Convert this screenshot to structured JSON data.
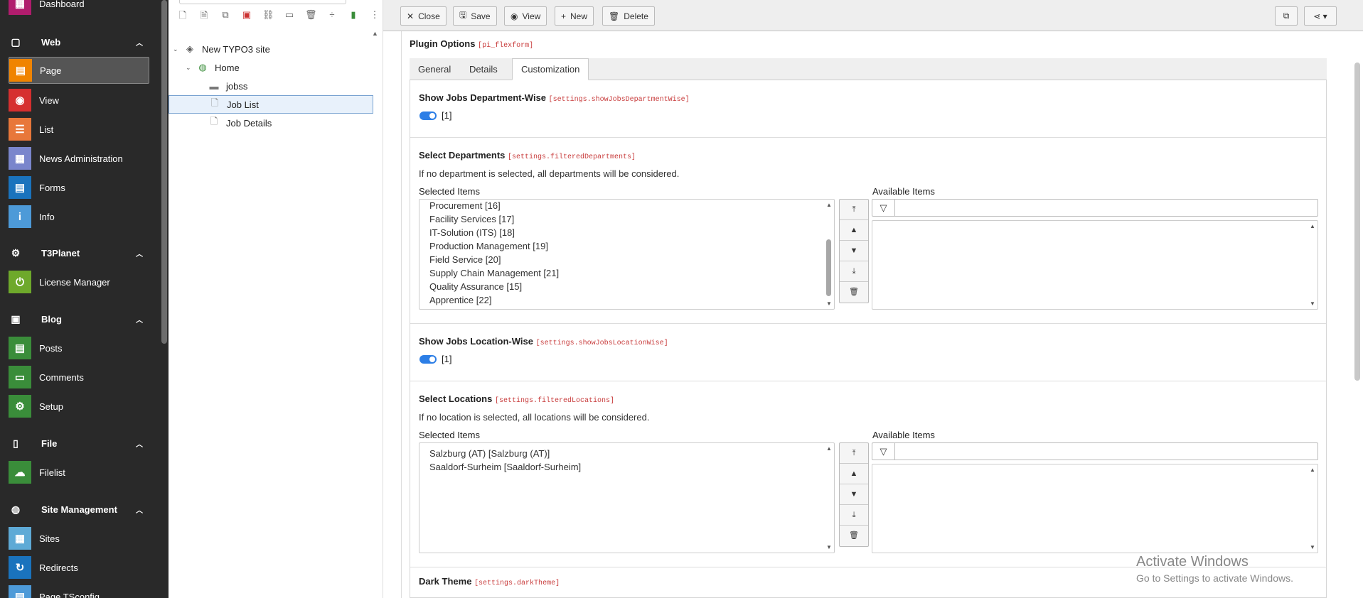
{
  "modmenu": {
    "top_item": "Dashboard",
    "sections": {
      "web": "Web",
      "t3planet": "T3Planet",
      "blog": "Blog",
      "file": "File",
      "sitemgmt": "Site Management"
    },
    "items": {
      "page": "Page",
      "view": "View",
      "list": "List",
      "news": "News Administration",
      "forms": "Forms",
      "info": "Info",
      "license": "License Manager",
      "posts": "Posts",
      "comments": "Comments",
      "setup": "Setup",
      "filelist": "Filelist",
      "sites": "Sites",
      "redirects": "Redirects",
      "tsconfig": "Page TSconfig"
    },
    "colors": {
      "dashboard": "#b01c6d",
      "page": "#f08400",
      "view": "#d62f2f",
      "list": "#e8773a",
      "news": "#7a86cc",
      "forms": "#1a73bd",
      "info": "#4d9ad8",
      "license": "#6ea92b",
      "posts": "#3a8d3a",
      "comments": "#3a8d3a",
      "setup": "#3a8d3a",
      "filelist": "#3a8d3a",
      "sites": "#5eaad6",
      "redirects": "#1a73bd",
      "tsconfig": "#4d9ad8"
    }
  },
  "tree": {
    "root": "New TYPO3 site",
    "home": "Home",
    "jobss": "jobss",
    "joblist": "Job List",
    "jobdetails": "Job Details"
  },
  "docheader": {
    "close": "Close",
    "save": "Save",
    "view": "View",
    "new": "New",
    "delete": "Delete"
  },
  "form": {
    "plugin_options": "Plugin Options",
    "plugin_options_key": "[pi_flexform]",
    "tabs": [
      "General",
      "Details",
      "Customization"
    ],
    "dept_wise_label": "Show Jobs Department-Wise",
    "dept_wise_key": "[settings.showJobsDepartmentWise]",
    "dept_wise_value": "[1]",
    "select_depts_label": "Select Departments",
    "select_depts_key": "[settings.filteredDepartments]",
    "select_depts_desc": "If no department is selected, all departments will be considered.",
    "selected_items": "Selected Items",
    "available_items": "Available Items",
    "departments": [
      "Procurement [16]",
      "Facility Services [17]",
      "IT-Solution (ITS) [18]",
      "Production Management [19]",
      "Field Service [20]",
      "Supply Chain Management [21]",
      "Quality Assurance [15]",
      "Apprentice [22]"
    ],
    "loc_wise_label": "Show Jobs Location-Wise",
    "loc_wise_key": "[settings.showJobsLocationWise]",
    "loc_wise_value": "[1]",
    "select_locs_label": "Select Locations",
    "select_locs_key": "[settings.filteredLocations]",
    "select_locs_desc": "If no location is selected, all locations will be considered.",
    "locations": [
      "Salzburg (AT) [Salzburg (AT)]",
      "Saaldorf-Surheim [Saaldorf-Surheim]"
    ],
    "dark_theme_label": "Dark Theme",
    "dark_theme_key": "[settings.darkTheme]"
  },
  "watermark": {
    "title": "Activate Windows",
    "subtitle": "Go to Settings to activate Windows."
  }
}
